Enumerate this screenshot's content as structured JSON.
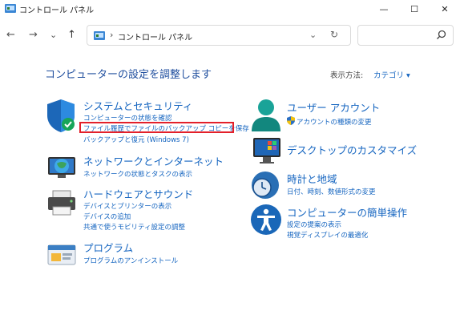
{
  "window": {
    "title": "コントロール パネル",
    "minimize_glyph": "—",
    "maximize_glyph": "☐",
    "close_glyph": "✕"
  },
  "nav": {
    "back_glyph": "←",
    "forward_glyph": "→",
    "recent_glyph": "⌄",
    "up_glyph": "↑"
  },
  "address": {
    "separator": "›",
    "crumb": "コントロール パネル",
    "dropdown_glyph": "⌄",
    "refresh_glyph": "↻"
  },
  "search": {
    "placeholder": ""
  },
  "main": {
    "heading": "コンピューターの設定を調整します",
    "view_by_label": "表示方法:",
    "view_by_value": "カテゴリ ▾"
  },
  "categories": {
    "system": {
      "title": "システムとセキュリティ",
      "links": [
        "コンピューターの状態を確認",
        "ファイル履歴でファイルのバックアップ コピーを保存",
        "バックアップと復元 (Windows 7)"
      ]
    },
    "network": {
      "title": "ネットワークとインターネット",
      "links": [
        "ネットワークの状態とタスクの表示"
      ]
    },
    "hardware": {
      "title": "ハードウェアとサウンド",
      "links": [
        "デバイスとプリンターの表示",
        "デバイスの追加",
        "共通で使うモビリティ設定の調整"
      ]
    },
    "programs": {
      "title": "プログラム",
      "links": [
        "プログラムのアンインストール"
      ]
    },
    "user": {
      "title": "ユーザー アカウント",
      "links": [
        "アカウントの種類の変更"
      ]
    },
    "desktop": {
      "title": "デスクトップのカスタマイズ",
      "links": []
    },
    "clock": {
      "title": "時計と地域",
      "links": [
        "日付、時刻、数値形式の変更"
      ]
    },
    "ease": {
      "title": "コンピューターの簡単操作",
      "links": [
        "設定の提案の表示",
        "視覚ディスプレイの最適化"
      ]
    }
  },
  "colors": {
    "link": "#1565c0",
    "heading": "#1f4e9e",
    "highlight": "#e3202a"
  }
}
